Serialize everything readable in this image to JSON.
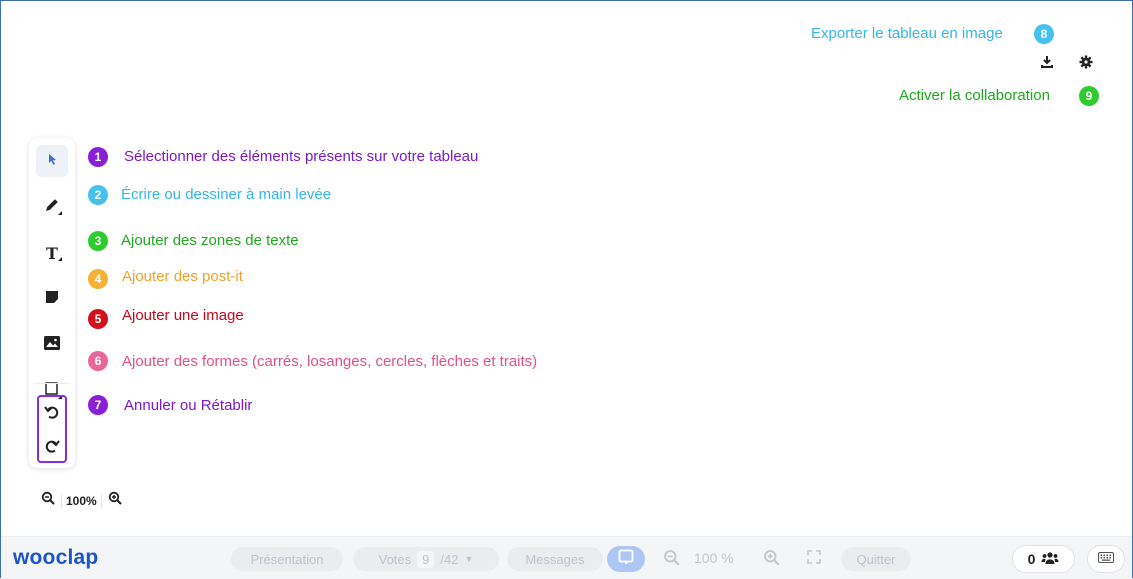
{
  "annotations": [
    {
      "num": "1",
      "text": "Sélectionner des éléments présents sur votre tableau",
      "color": "#7c18c9",
      "badge": "#8a1fd6"
    },
    {
      "num": "2",
      "text": "Écrire ou dessiner à main levée",
      "color": "#35b6e6",
      "badge": "#45c1ee"
    },
    {
      "num": "3",
      "text": "Ajouter des zones de texte",
      "color": "#1ea81e",
      "badge": "#2fcc2f"
    },
    {
      "num": "4",
      "text": "Ajouter des post-it",
      "color": "#f2a12b",
      "badge": "#f5b236"
    },
    {
      "num": "5",
      "text": "Ajouter une image",
      "color": "#c4081a",
      "badge": "#d3101c"
    },
    {
      "num": "6",
      "text": "Ajouter des formes (carrés, losanges, cercles, flèches et traits)",
      "color": "#e0508c",
      "badge": "#e8669a"
    },
    {
      "num": "7",
      "text": "Annuler ou Rétablir",
      "color": "#7c18c9",
      "badge": "#8a1fd6"
    },
    {
      "num": "8",
      "text": "Exporter le tableau en image",
      "color": "#35b6e6",
      "badge": "#45c1ee"
    },
    {
      "num": "9",
      "text": "Activer la collaboration",
      "color": "#1ea81e",
      "badge": "#2fcc2f"
    }
  ],
  "toolbar": {
    "tools": [
      "select-arrow-icon",
      "pen-icon",
      "text-tool-icon",
      "sticky-note-icon",
      "image-icon",
      "shape-square-icon"
    ],
    "undo_icon": "undo-icon",
    "redo_icon": "redo-icon"
  },
  "zoom": {
    "value": "100%"
  },
  "bottom": {
    "logo": "wooclap",
    "presentation": "Présentation",
    "votes": "Votes",
    "votes_current": "9",
    "votes_total": "/42",
    "messages": "Messages",
    "zoom_value": "100 %",
    "quit": "Quitter",
    "participants": "0"
  },
  "colors": {
    "brand": "#1a56c8",
    "frame": "#3d6fb0",
    "undo_highlight": "#8a2be2"
  }
}
